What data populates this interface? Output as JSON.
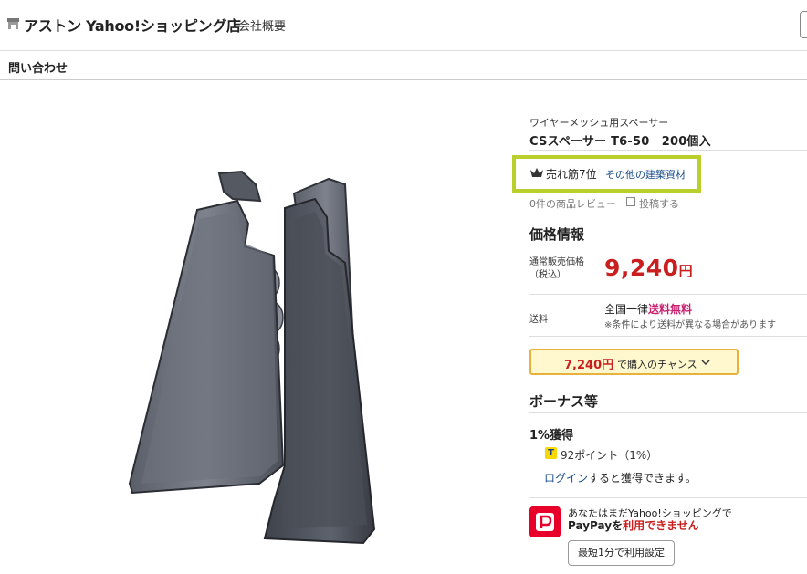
{
  "header": {
    "store_name": "アストン Yahoo!ショッピング店",
    "company_link": "会社概要",
    "inquiry": "問い合わせ"
  },
  "product": {
    "subtitle": "ワイヤーメッシュ用スペーサー",
    "title": "CSスペーサー T6-50　200個入",
    "rank_text": "売れ筋7位",
    "rank_category": "その他の建築資材",
    "review_count": "0件の商品レビュー",
    "post_link": "投稿する"
  },
  "price_section": {
    "heading": "価格情報",
    "regular_label": "通常販売価格（税込）",
    "price_number": "9,240",
    "price_unit": "円",
    "shipping_label": "送料",
    "shipping_prefix": "全国一律",
    "shipping_free": "送料無料",
    "shipping_note": "※条件により送料が異なる場合があります",
    "chance_price": "7,240円",
    "chance_text": "で購入のチャンス"
  },
  "bonus": {
    "heading": "ボーナス等",
    "earn": "1%獲得",
    "tpoint_mark": "T",
    "points": "92ポイント（1%）",
    "login_link": "ログイン",
    "login_rest": "すると獲得できます。"
  },
  "paypay": {
    "line1": "あなたはまだYahoo!ショッピングで",
    "line2_a": "PayPayを",
    "line2_b": "利用できません",
    "setup_button": "最短1分で利用設定"
  },
  "colors": {
    "price_red": "#c91f1f",
    "rank_highlight": "#b9d02c",
    "link_blue": "#1a4c8a",
    "paypay_red": "#e8002a"
  }
}
